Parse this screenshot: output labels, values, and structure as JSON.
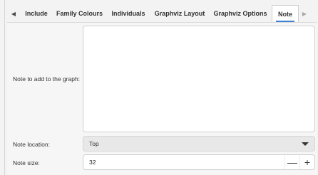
{
  "tabs": {
    "scroll_left_icon": "◀",
    "scroll_right_icon": "▶",
    "items": [
      {
        "label": "Include"
      },
      {
        "label": "Family Colours"
      },
      {
        "label": "Individuals"
      },
      {
        "label": "Graphviz Layout"
      },
      {
        "label": "Graphviz Options"
      },
      {
        "label": "Note",
        "active": true
      }
    ]
  },
  "form": {
    "note_label": "Note to add to the graph:",
    "note_value": "",
    "location_label": "Note location:",
    "location_value": "Top",
    "size_label": "Note size:",
    "size_value": "32",
    "minus_icon": "—",
    "plus_icon": "+"
  },
  "colors": {
    "accent": "#3b82d6",
    "background": "#f3f3f3"
  }
}
